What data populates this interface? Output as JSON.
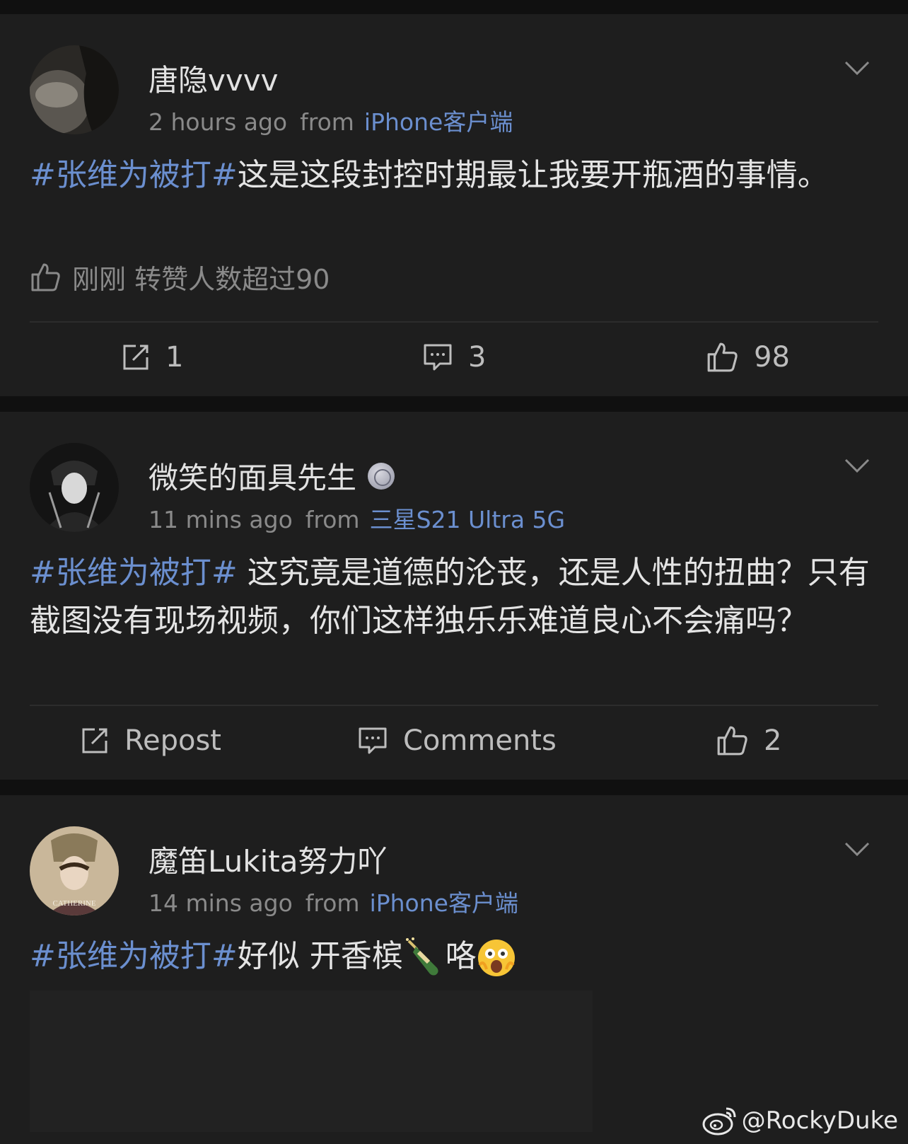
{
  "posts": [
    {
      "username": "唐隐vvvv",
      "time": "2 hours ago",
      "from_label": "from",
      "source": "iPhone客户端",
      "hashtag": "#张维为被打#",
      "text": "这是这段封控时期最让我要开瓶酒的事情。",
      "notice": "刚刚 转赞人数超过90",
      "actions": {
        "repost": "1",
        "comments": "3",
        "likes": "98"
      }
    },
    {
      "username": "微笑的面具先生",
      "badge_icon": "medal-icon",
      "time": "11 mins ago",
      "from_label": "from",
      "source": "三星S21 Ultra 5G",
      "hashtag": "#张维为被打#",
      "text": " 这究竟是道德的沦丧，还是人性的扭曲？只有截图没有现场视频，你们这样独乐乐难道良心不会痛吗？",
      "actions": {
        "repost": "Repost",
        "comments": "Comments",
        "likes": "2"
      }
    },
    {
      "username": "魔笛Lukita努力吖",
      "avatar_caption": "CATHERINE",
      "time": "14 mins ago",
      "from_label": "from",
      "source": "iPhone客户端",
      "hashtag": "#张维为被打#",
      "text": "好似 开香槟",
      "text_end": "咯",
      "emojis": [
        "champagne-icon",
        "shocked-face-icon"
      ]
    }
  ],
  "watermark": "@RockyDuke",
  "colors": {
    "link": "#6b8fcf",
    "card": "#1e1e1e",
    "background": "#101010"
  }
}
